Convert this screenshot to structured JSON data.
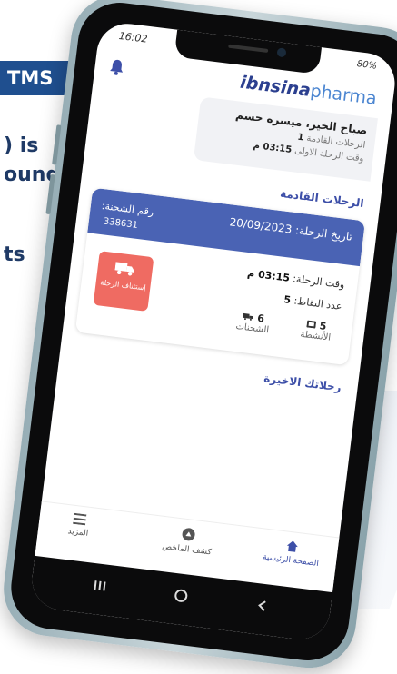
{
  "background": {
    "tag": "TMS",
    "lines": [
      ") is",
      "ound",
      "ts"
    ]
  },
  "status": {
    "time": "16:02",
    "right": "80%"
  },
  "app": {
    "logo_bold": "ibnsina",
    "logo_light": "pharma"
  },
  "greeting": {
    "title": "صباح الخير، ميسره حسم",
    "upcoming_label": "الرحلات القادمة",
    "upcoming_count": "1",
    "first_trip_label": "وقت الرحلة الاولى",
    "first_trip_time": "03:15 م"
  },
  "sections": {
    "upcoming": "الرحلات القادمة",
    "last": "رحلاتك الاخيرة"
  },
  "trip": {
    "date_label": "تاريخ الرحلة:",
    "date_value": "20/09/2023",
    "shipment_label": "رقم الشحنة:",
    "shipment_value": "338631",
    "time_label": "وقت الرحلة:",
    "time_value": "03:15 م",
    "points_label": "عدد النقاط:",
    "points_value": "5",
    "activities_count": "5",
    "activities_label": "الأنشطة",
    "shipments_count": "6",
    "shipments_label": "الشحنات",
    "resume_label": "إستئناف الرحلة"
  },
  "nav": {
    "home": "الصفحة الرئيسية",
    "summary": "كشف الملخص",
    "more": "المزيد"
  },
  "colors": {
    "brand_blue": "#4a63b4",
    "accent_red": "#ef6b62",
    "logo_blue": "#2b3f8f"
  }
}
